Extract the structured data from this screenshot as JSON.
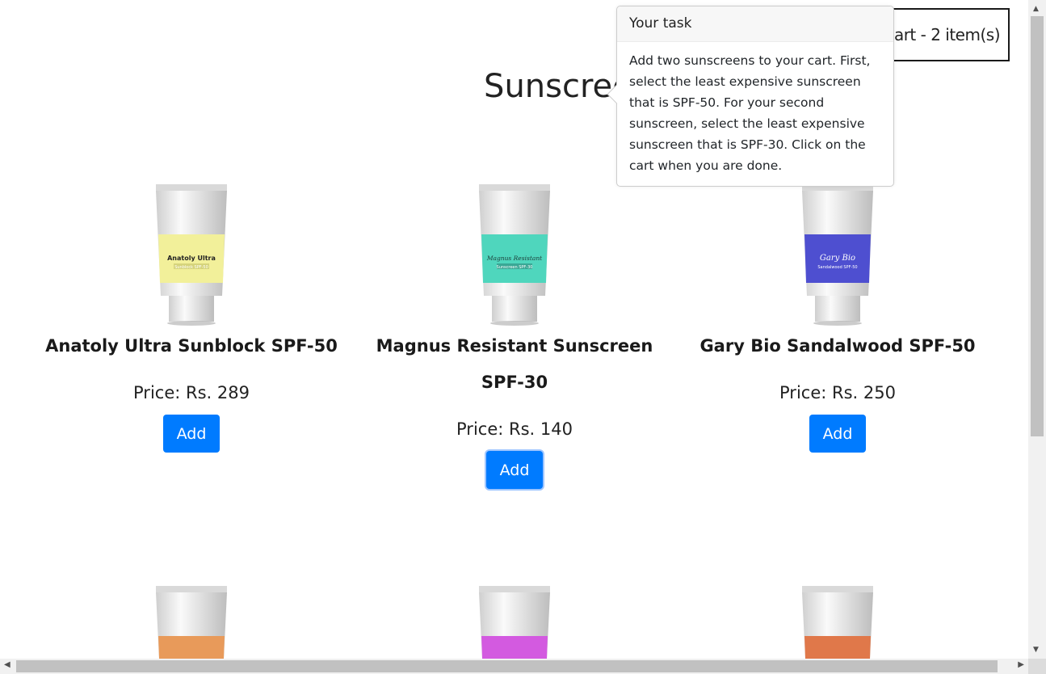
{
  "cart": {
    "label": "Cart - 2 item(s)"
  },
  "page": {
    "title": "Sunscreens",
    "info_icon": "info-icon"
  },
  "popover": {
    "header": "Your task",
    "body": "Add two sunscreens to your cart. First, select the least expensive sunscreen that is SPF-50. For your second sunscreen, select the least expensive sunscreen that is SPF-30. Click on the cart when you are done."
  },
  "products": [
    {
      "name": "Anatoly Ultra Sunblock SPF-50",
      "price": "Price: Rs. 289",
      "button": "Add",
      "label_line1": "Anatoly Ultra",
      "label_line2": "Sunblock SPF-50",
      "color": "#f2f09a"
    },
    {
      "name": "Magnus Resistant Sunscreen SPF-30",
      "price": "Price: Rs. 140",
      "button": "Add",
      "label_line1": "Magnus Resistant",
      "label_line2": "Sunscreen SPF-30",
      "color": "#4fd6bd"
    },
    {
      "name": "Gary Bio Sandalwood SPF-50",
      "price": "Price: Rs. 250",
      "button": "Add",
      "label_line1": "Gary Bio",
      "label_line2": "Sandalwood SPF-50",
      "color": "#4e4fd0"
    }
  ],
  "partial_products": [
    {
      "color": "#e89a5a"
    },
    {
      "color": "#d35ae0"
    },
    {
      "color": "#e0784a"
    }
  ]
}
